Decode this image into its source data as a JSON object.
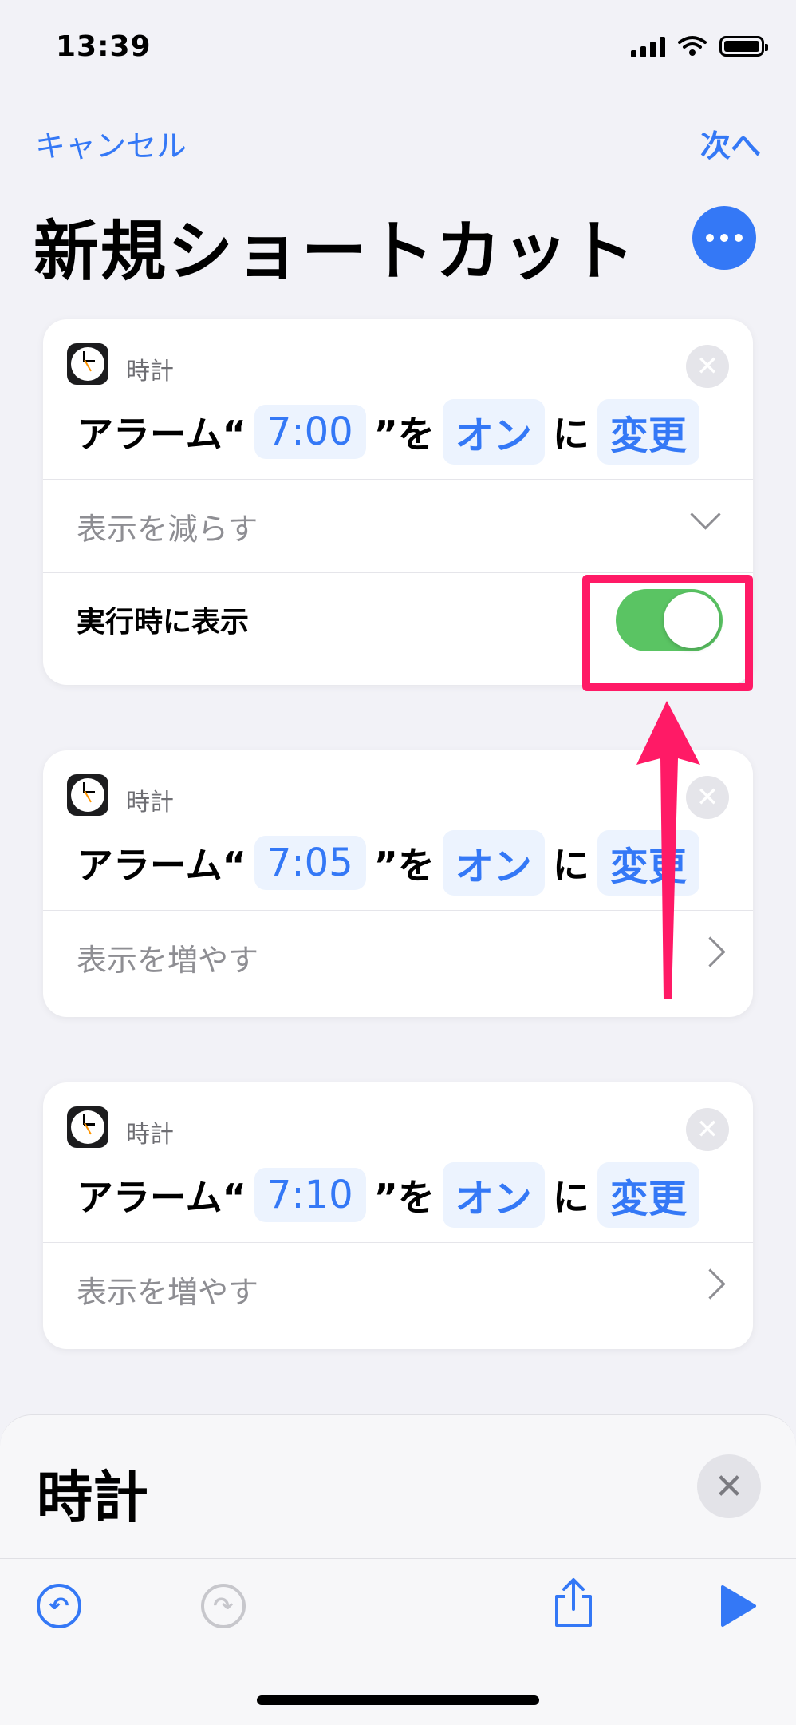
{
  "status": {
    "time": "13:39"
  },
  "nav": {
    "cancel": "キャンセル",
    "next": "次へ"
  },
  "title": "新規ショートカット",
  "cards": [
    {
      "app": "時計",
      "parts": [
        "アラーム“",
        "7:00",
        "”を",
        "オン",
        "に",
        "変更"
      ],
      "row_label": "表示を減らす",
      "toggle_label": "実行時に表示",
      "toggle_on": true
    },
    {
      "app": "時計",
      "parts": [
        "アラーム“",
        "7:05",
        "”を",
        "オン",
        "に",
        "変更"
      ],
      "row_label": "表示を増やす"
    },
    {
      "app": "時計",
      "parts": [
        "アラーム“",
        "7:10",
        "”を",
        "オン",
        "に",
        "変更"
      ],
      "row_label": "表示を増やす"
    }
  ],
  "sheet": {
    "title": "時計"
  },
  "colors": {
    "accent": "#3478f6",
    "toggle": "#5ac463",
    "annotation": "#ff1a66"
  }
}
